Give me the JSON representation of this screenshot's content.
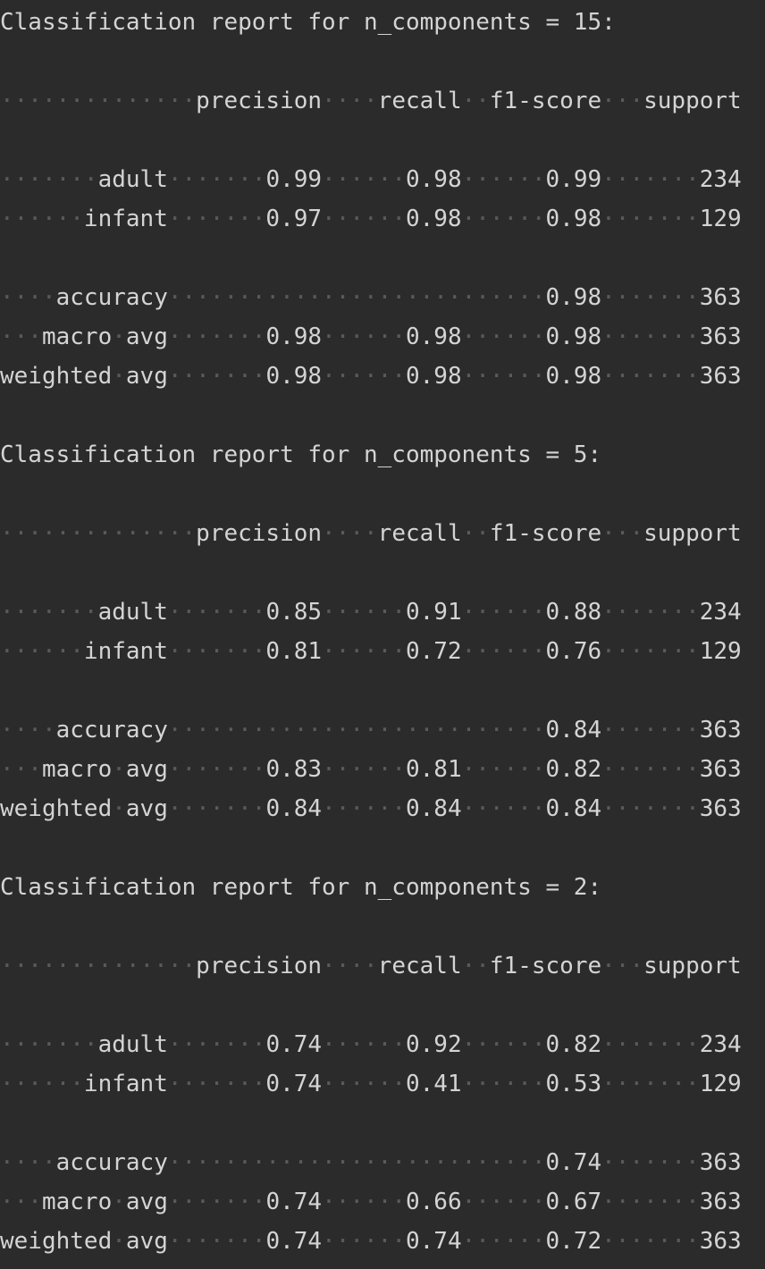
{
  "console": {
    "reports": [
      {
        "title": "Classification report for n_components = 15:",
        "header": [
          "precision",
          "recall",
          "f1-score",
          "support"
        ],
        "rows": [
          {
            "label": "adult",
            "precision": "0.99",
            "recall": "0.98",
            "f1": "0.99",
            "support": "234"
          },
          {
            "label": "infant",
            "precision": "0.97",
            "recall": "0.98",
            "f1": "0.98",
            "support": "129"
          }
        ],
        "accuracy": {
          "label": "accuracy",
          "f1": "0.98",
          "support": "363"
        },
        "macro": {
          "label": "macro avg",
          "precision": "0.98",
          "recall": "0.98",
          "f1": "0.98",
          "support": "363"
        },
        "weighted": {
          "label": "weighted avg",
          "precision": "0.98",
          "recall": "0.98",
          "f1": "0.98",
          "support": "363"
        }
      },
      {
        "title": "Classification report for n_components = 5:",
        "header": [
          "precision",
          "recall",
          "f1-score",
          "support"
        ],
        "rows": [
          {
            "label": "adult",
            "precision": "0.85",
            "recall": "0.91",
            "f1": "0.88",
            "support": "234"
          },
          {
            "label": "infant",
            "precision": "0.81",
            "recall": "0.72",
            "f1": "0.76",
            "support": "129"
          }
        ],
        "accuracy": {
          "label": "accuracy",
          "f1": "0.84",
          "support": "363"
        },
        "macro": {
          "label": "macro avg",
          "precision": "0.83",
          "recall": "0.81",
          "f1": "0.82",
          "support": "363"
        },
        "weighted": {
          "label": "weighted avg",
          "precision": "0.84",
          "recall": "0.84",
          "f1": "0.84",
          "support": "363"
        }
      },
      {
        "title": "Classification report for n_components = 2:",
        "header": [
          "precision",
          "recall",
          "f1-score",
          "support"
        ],
        "rows": [
          {
            "label": "adult",
            "precision": "0.74",
            "recall": "0.92",
            "f1": "0.82",
            "support": "234"
          },
          {
            "label": "infant",
            "precision": "0.74",
            "recall": "0.41",
            "f1": "0.53",
            "support": "129"
          }
        ],
        "accuracy": {
          "label": "accuracy",
          "f1": "0.74",
          "support": "363"
        },
        "macro": {
          "label": "macro avg",
          "precision": "0.74",
          "recall": "0.66",
          "f1": "0.67",
          "support": "363"
        },
        "weighted": {
          "label": "weighted avg",
          "precision": "0.74",
          "recall": "0.74",
          "f1": "0.72",
          "support": "363"
        }
      }
    ]
  }
}
